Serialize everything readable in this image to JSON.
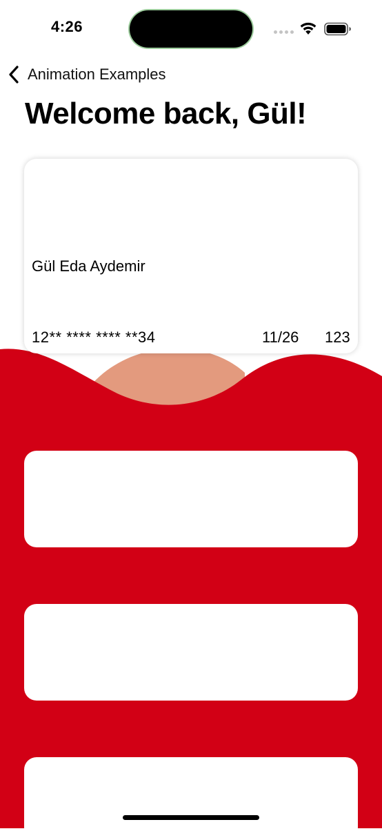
{
  "status_bar": {
    "time": "4:26",
    "icons": [
      "cellular-dots-icon",
      "wifi-icon",
      "battery-icon"
    ]
  },
  "nav": {
    "back_label": "Animation Examples",
    "back_icon": "chevron-left-icon"
  },
  "page": {
    "title": "Welcome back, Gül!"
  },
  "card": {
    "holder_name": "Gül Eda Aydemir",
    "number": "12** **** **** **34",
    "expiry": "11/26",
    "cvv": "123"
  },
  "colors": {
    "background": "#ffffff",
    "wave_red": "#d20015",
    "wave_peach": "#e39a7e",
    "card": "#ffffff"
  }
}
